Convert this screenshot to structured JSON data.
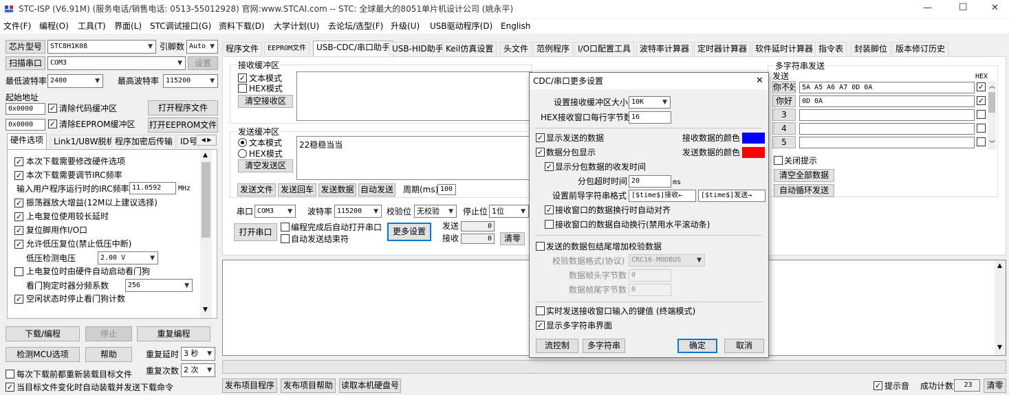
{
  "window": {
    "title": "STC-ISP (V6.91M) (服务电话/销售电话: 0513-55012928) 官网:www.STCAI.com  -- STC: 全球最大的8051单片机设计公司 (姚永平)",
    "minimize": "—",
    "maximize": "☐",
    "close": "✕"
  },
  "menu": [
    "文件(F)",
    "编程(O)",
    "工具(T)",
    "界面(L)",
    "STC调试接口(G)",
    "资料下载(D)",
    "大学计划(U)",
    "去论坛/选型(F)",
    "升级(U)",
    "USB驱动程序(D)",
    "English"
  ],
  "left": {
    "chip_label": "芯片型号",
    "chip_value": "STC8H1K08",
    "pin_label": "引脚数",
    "pin_value": "Auto",
    "scan_label": "扫描串口",
    "port_value": "COM3",
    "settings_label": "设置",
    "min_baud_label": "最低波特率",
    "min_baud_value": "2400",
    "max_baud_label": "最高波特率",
    "max_baud_value": "115200",
    "start_addr_label": "起始地址",
    "addr1": "0x0000",
    "clear_code_label": "清除代码缓冲区",
    "open_prog_label": "打开程序文件",
    "addr2": "0x0000",
    "clear_eeprom_label": "清除EEPROM缓冲区",
    "open_eeprom_label": "打开EEPROM文件",
    "tabs": [
      "硬件选项",
      "Link1/U8W脱机",
      "程序加密后传输",
      "ID号"
    ],
    "options": [
      {
        "label": "本次下载需要修改硬件选项",
        "checked": true
      },
      {
        "label": "本次下载需要调节IRC频率",
        "checked": true
      },
      {
        "label": "输入用户程序运行时的IRC频率",
        "value": "11.0592",
        "unit": "MHz"
      },
      {
        "label": "振荡器放大增益(12M以上建议选择)",
        "checked": true
      },
      {
        "label": "上电复位使用较长延时",
        "checked": true
      },
      {
        "label": "复位脚用作I/O口",
        "checked": true
      },
      {
        "label": "允许低压复位(禁止低压中断)",
        "checked": true
      },
      {
        "label": "低压检测电压",
        "value": "2.00 V"
      },
      {
        "label": "上电复位时由硬件自动启动看门狗",
        "checked": false
      },
      {
        "label": "看门狗定时器分频系数",
        "value": "256"
      },
      {
        "label": "空闲状态时停止看门狗计数",
        "checked": true
      }
    ],
    "download_label": "下载/编程",
    "stop_label": "停止",
    "reprogram_label": "重复编程",
    "check_mcu_label": "检测MCU选项",
    "help_label": "帮助",
    "retry_delay_label": "重复延时",
    "retry_delay_value": "3 秒",
    "reload_label": "每次下载前都重新装载目标文件",
    "retry_count_label": "重复次数",
    "retry_count_value": "2 次",
    "auto_send_label": "当目标文件变化时自动装载并发送下载命令"
  },
  "right_tabs": [
    "程序文件",
    "EEPROM文件",
    "USB-CDC/串口助手",
    "USB-HID助手",
    "Keil仿真设置",
    "头文件",
    "范例程序",
    "I/O口配置工具",
    "波特率计算器",
    "定时器计算器",
    "软件延时计算器",
    "指令表",
    "封装脚位",
    "版本修订历史"
  ],
  "receive": {
    "title": "接收缓冲区",
    "text_mode": "文本模式",
    "hex_mode": "HEX模式",
    "clear": "清空接收区"
  },
  "send": {
    "title": "发送缓冲区",
    "text_mode": "文本模式",
    "hex_mode": "HEX模式",
    "clear": "清空发送区",
    "content": "22稳稳当当",
    "send_file": "发送文件",
    "send_return": "发送回车",
    "send_data": "发送数据",
    "auto_send": "自动发送",
    "period_label": "周期(ms)",
    "period_value": "100"
  },
  "serial": {
    "port_label": "串口",
    "port_value": "COM3",
    "baud_label": "波特率",
    "baud_value": "115200",
    "parity_label": "校验位",
    "parity_value": "无校验",
    "stop_label": "停止位",
    "stop_value": "1位",
    "open_label": "打开串口",
    "auto_open_label": "编程完成后自动打开串口",
    "auto_end_label": "自动发送结束符",
    "more_label": "更多设置",
    "sent_label": "发送",
    "sent_value": "0",
    "recv_label": "接收",
    "recv_value": "0",
    "clear_label": "清零"
  },
  "multi": {
    "title": "多字符串发送",
    "send_col": "发送",
    "hex_col": "HEX",
    "rows": [
      {
        "button": "你不好",
        "value": "5A A5 A6 A7 0D 0A",
        "hex": true
      },
      {
        "button": "你好",
        "value": "0D 0A",
        "hex": true
      },
      {
        "button": "3",
        "value": "",
        "hex": false
      },
      {
        "button": "4",
        "value": "",
        "hex": false
      },
      {
        "button": "5",
        "value": "",
        "hex": false
      }
    ],
    "close_hint": "关闭提示",
    "clear_all": "清空全部数据",
    "auto_loop": "自动循环发送"
  },
  "bottom": {
    "publish_prog": "发布项目程序",
    "publish_help": "发布项目帮助",
    "read_disk": "读取本机硬盘号",
    "sound_label": "提示音",
    "success_label": "成功计数",
    "success_value": "23",
    "clear_label": "清零"
  },
  "dialog": {
    "title": "CDC/串口更多设置",
    "close": "✕",
    "rx_size_label": "设置接收缓冲区大小",
    "rx_size_value": "10K",
    "hex_bytes_label": "HEX接收窗口每行字节数",
    "hex_bytes_value": "16",
    "show_sent_label": "显示发送的数据",
    "rx_color_label": "接收数据的颜色",
    "rx_color": "#0000ff",
    "packet_label": "数据分包显示",
    "tx_color_label": "发送数据的颜色",
    "tx_color": "#ff0000",
    "show_time_label": "显示分包数据的收发时间",
    "timeout_label": "分包超时时间",
    "timeout_value": "20",
    "timeout_unit": "ms",
    "prefix_label": "设置前导字符串格式",
    "rx_prefix": "[$time$]接收←",
    "tx_prefix": "[$time$]发送→",
    "auto_align_label": "接收窗口的数据换行时自动对齐",
    "auto_wrap_label": "接收窗口的数据自动换行(禁用水平滚动条)",
    "checksum_label": "发送的数据包结尾增加校验数据",
    "check_format_label": "校验数据格式(协议)",
    "check_format_value": "CRC16-MODBUS",
    "head_bytes_label": "数据帧头字节数",
    "head_bytes_value": "0",
    "tail_bytes_label": "数据帧尾字节数",
    "tail_bytes_value": "0",
    "realtime_label": "实时发送接收窗口输入的键值 (终端模式)",
    "show_multi_label": "显示多字符串界面",
    "flow_label": "流控制",
    "multi_label": "多字符串",
    "ok_label": "确定",
    "cancel_label": "取消"
  }
}
